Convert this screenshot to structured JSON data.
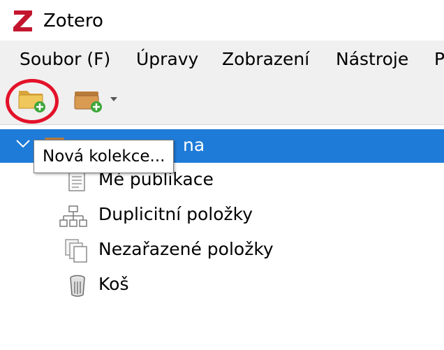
{
  "window": {
    "title": "Zotero"
  },
  "menubar": {
    "items": [
      "Soubor (F)",
      "Úpravy",
      "Zobrazení",
      "Nástroje",
      "P"
    ]
  },
  "toolbar": {
    "new_collection_icon": "folder-add-icon",
    "new_library_icon": "library-add-icon",
    "dropdown_icon": "chevron-down-icon"
  },
  "tooltip": {
    "text": "Nová kolekce..."
  },
  "tree": {
    "selected_item_visible_fragment": "na",
    "items": [
      {
        "label": "Mé publikace",
        "icon": "document-icon"
      },
      {
        "label": "Duplicitní položky",
        "icon": "duplicates-icon"
      },
      {
        "label": "Nezařazené položky",
        "icon": "unfiled-icon"
      },
      {
        "label": "Koš",
        "icon": "trash-icon"
      }
    ]
  },
  "colors": {
    "selection": "#1f7bd8",
    "highlight_circle": "#e3122a",
    "logo": "#c3162e",
    "folder": "#e7b84a",
    "add_badge": "#3ea63a"
  }
}
